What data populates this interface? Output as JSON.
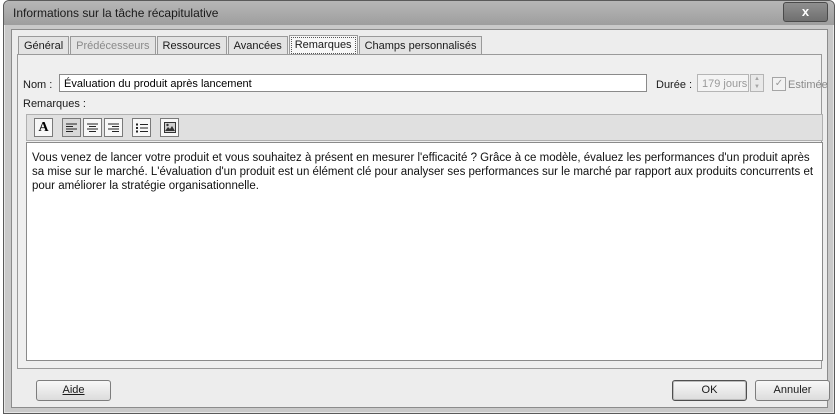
{
  "window": {
    "title": "Informations sur la tâche récapitulative",
    "close_label": "x"
  },
  "tabs": [
    {
      "label": "Général",
      "state": "normal"
    },
    {
      "label": "Prédécesseurs",
      "state": "disabled"
    },
    {
      "label": "Ressources",
      "state": "normal"
    },
    {
      "label": "Avancées",
      "state": "normal"
    },
    {
      "label": "Remarques",
      "state": "active"
    },
    {
      "label": "Champs personnalisés",
      "state": "normal"
    }
  ],
  "form": {
    "nom_label": "Nom :",
    "nom_value": "Évaluation du produit après lancement",
    "duree_label": "Durée :",
    "duree_value": "179 jours",
    "estimee_label": "Estimée",
    "estimee_checked": true,
    "remarques_label": "Remarques :"
  },
  "toolbar": {
    "font_glyph": "A",
    "buttons": [
      "font-icon",
      "align-left-icon",
      "align-center-icon",
      "align-right-icon",
      "bullet-list-icon",
      "insert-object-icon"
    ]
  },
  "notes": {
    "text": "Vous venez de lancer votre produit et vous souhaitez à présent en mesurer l'efficacité ?  Grâce à ce modèle, évaluez les performances d'un produit après sa mise sur le marché. L'évaluation d'un produit est un élément clé pour analyser ses performances sur le marché par rapport aux produits concurrents et pour améliorer la stratégie organisationnelle."
  },
  "buttons": {
    "aide": "Aide",
    "ok": "OK",
    "annuler": "Annuler"
  }
}
